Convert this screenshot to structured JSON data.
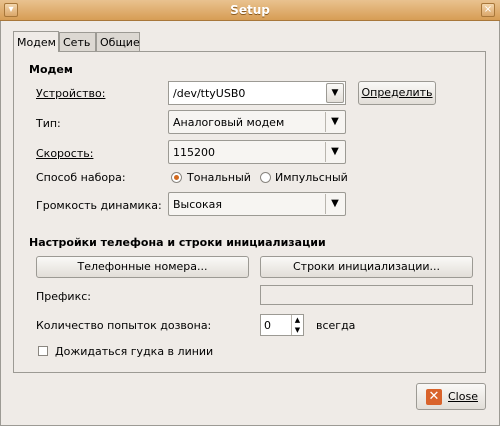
{
  "window": {
    "title": "Setup",
    "close_glyph": "×"
  },
  "tabs": [
    {
      "label": "Модем",
      "active": true
    },
    {
      "label": "Сеть",
      "active": false
    },
    {
      "label": "Общие",
      "active": false
    }
  ],
  "modem_section": {
    "title": "Модем",
    "device": {
      "label": "Устройство:",
      "value": "/dev/ttyUSB0",
      "detect_button": "Определить"
    },
    "type": {
      "label": "Тип:",
      "value": "Аналоговый модем"
    },
    "speed": {
      "label": "Скорость:",
      "value": "115200"
    },
    "dialing": {
      "label": "Способ набора:",
      "tone": "Тональный",
      "pulse": "Импульсный",
      "selected": "tone"
    },
    "volume": {
      "label": "Громкость динамика:",
      "value": "Высокая"
    }
  },
  "init_section": {
    "title": "Настройки телефона и строки инициализации",
    "phone_numbers_button": "Телефонные номера...",
    "init_strings_button": "Строки инициализации...",
    "prefix": {
      "label": "Префикс:",
      "value": ""
    },
    "retries": {
      "label": "Количество попыток дозвона:",
      "value": "0",
      "suffix": "всегда"
    },
    "wait_dialtone": {
      "label": "Дожидаться гудка в линии",
      "checked": false
    }
  },
  "footer": {
    "close_button": "Close"
  },
  "colors": {
    "titlebar": "#d79d55",
    "accent_radio": "#d2691e",
    "close_icon": "#d9632b"
  },
  "icons": [
    "close-window-icon",
    "dropdown-arrow-icon",
    "close-icon"
  ]
}
